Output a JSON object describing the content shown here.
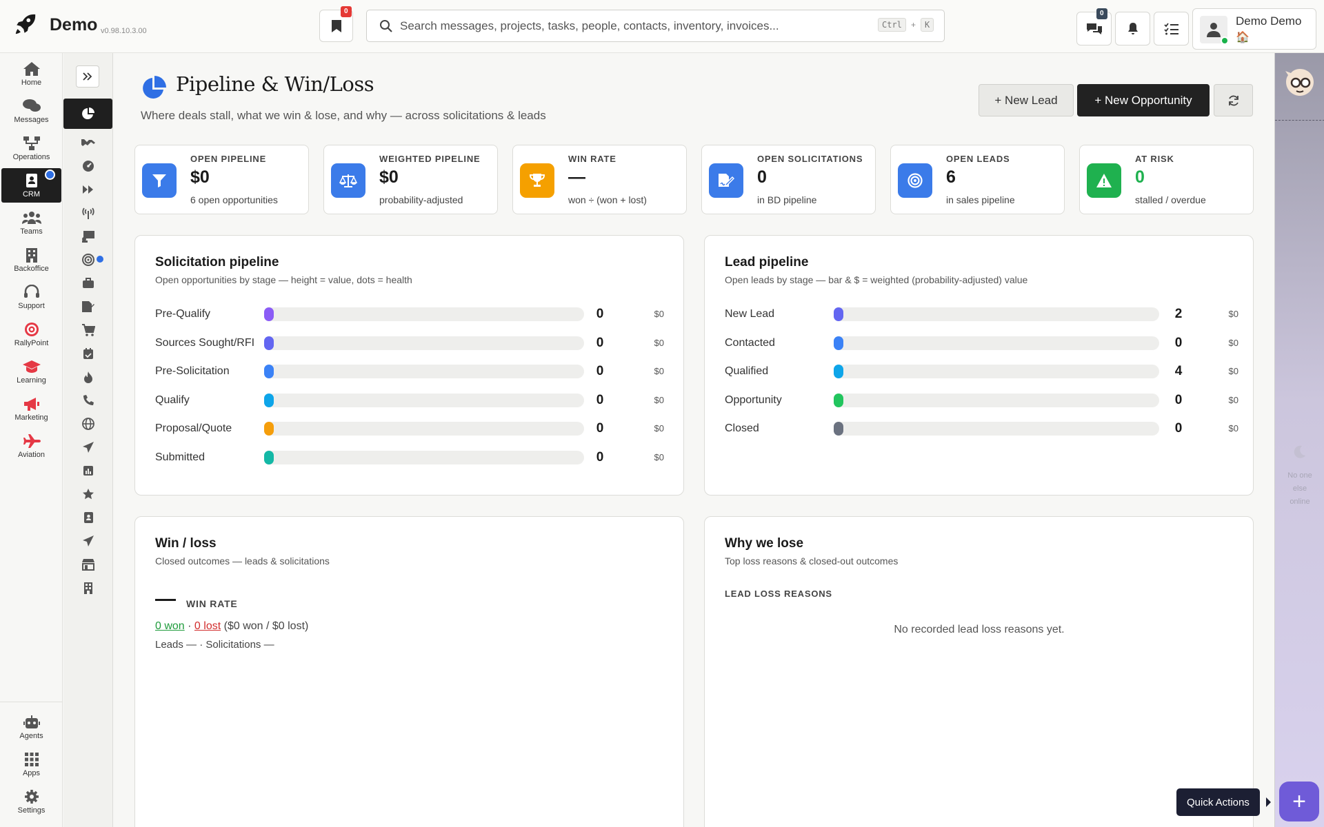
{
  "app": {
    "name": "Demo",
    "version": "v0.98.10.3.00"
  },
  "topbar": {
    "bookmark_badge": "0",
    "search_placeholder": "Search messages, projects, tasks, people, contacts, inventory, invoices...",
    "shortcut_ctrl": "Ctrl",
    "shortcut_plus": "+",
    "shortcut_key": "K",
    "chat_badge": "0",
    "user_name": "Demo Demo",
    "user_home_icon": "🏠"
  },
  "leftnav": {
    "items": [
      {
        "label": "Home",
        "icon": "home-icon"
      },
      {
        "label": "Messages",
        "icon": "messages-icon"
      },
      {
        "label": "Operations",
        "icon": "operations-icon"
      },
      {
        "label": "CRM",
        "icon": "crm-icon",
        "active": true
      },
      {
        "label": "Teams",
        "icon": "teams-icon"
      },
      {
        "label": "Backoffice",
        "icon": "building-icon"
      },
      {
        "label": "Support",
        "icon": "headset-icon"
      },
      {
        "label": "RallyPoint",
        "icon": "target-icon"
      },
      {
        "label": "Learning",
        "icon": "graduation-icon"
      },
      {
        "label": "Marketing",
        "icon": "megaphone-icon"
      },
      {
        "label": "Aviation",
        "icon": "plane-icon"
      }
    ],
    "bottom": [
      {
        "label": "Agents",
        "icon": "robot-icon"
      },
      {
        "label": "Apps",
        "icon": "grid-icon"
      },
      {
        "label": "Settings",
        "icon": "gear-icon"
      }
    ]
  },
  "rightrail": {
    "presence_text": [
      "No one",
      "else",
      "online"
    ]
  },
  "page": {
    "title": "Pipeline & Win/Loss",
    "subtitle": "Where deals stall, what we win & lose, and why — across solicitations & leads",
    "new_lead": "+ New Lead",
    "new_opportunity": "+ New Opportunity"
  },
  "kpis": [
    {
      "label": "OPEN PIPELINE",
      "value": "$0",
      "note": "6 open opportunities",
      "color": "#3b7be9",
      "icon": "filter-icon"
    },
    {
      "label": "WEIGHTED PIPELINE",
      "value": "$0",
      "note": "probability-adjusted",
      "color": "#3b7be9",
      "icon": "scale-icon"
    },
    {
      "label": "WIN RATE",
      "value": "—",
      "note": "won ÷ (won + lost)",
      "color": "#f5a000",
      "icon": "trophy-icon"
    },
    {
      "label": "OPEN SOLICITATIONS",
      "value": "0",
      "note": "in BD pipeline",
      "color": "#3b7be9",
      "icon": "file-signature-icon"
    },
    {
      "label": "OPEN LEADS",
      "value": "6",
      "note": "in sales pipeline",
      "color": "#3b7be9",
      "icon": "bullseye-icon"
    },
    {
      "label": "AT RISK",
      "value": "0",
      "note": "stalled / overdue",
      "color": "#1fb14f",
      "value_color": "#1fb14f",
      "icon": "warning-icon"
    }
  ],
  "solicitation_pipeline": {
    "title": "Solicitation pipeline",
    "subtitle": "Open opportunities by stage — height = value, dots = health",
    "stages": [
      {
        "label": "Pre-Qualify",
        "count": "0",
        "amount": "$0",
        "color": "#8b5cf6"
      },
      {
        "label": "Sources Sought/RFI",
        "count": "0",
        "amount": "$0",
        "color": "#6366f1"
      },
      {
        "label": "Pre-Solicitation",
        "count": "0",
        "amount": "$0",
        "color": "#3b82f6"
      },
      {
        "label": "Qualify",
        "count": "0",
        "amount": "$0",
        "color": "#0ea5e9"
      },
      {
        "label": "Proposal/Quote",
        "count": "0",
        "amount": "$0",
        "color": "#f59e0b"
      },
      {
        "label": "Submitted",
        "count": "0",
        "amount": "$0",
        "color": "#14b8a6"
      }
    ]
  },
  "lead_pipeline": {
    "title": "Lead pipeline",
    "subtitle": "Open leads by stage — bar & $ = weighted (probability-adjusted) value",
    "stages": [
      {
        "label": "New Lead",
        "count": "2",
        "amount": "$0",
        "color": "#6366f1"
      },
      {
        "label": "Contacted",
        "count": "0",
        "amount": "$0",
        "color": "#3b82f6"
      },
      {
        "label": "Qualified",
        "count": "4",
        "amount": "$0",
        "color": "#0ea5e9"
      },
      {
        "label": "Opportunity",
        "count": "0",
        "amount": "$0",
        "color": "#22c55e"
      },
      {
        "label": "Closed",
        "count": "0",
        "amount": "$0",
        "color": "#6b7280"
      }
    ]
  },
  "win_loss": {
    "title": "Win / loss",
    "subtitle": "Closed outcomes — leads & solicitations",
    "win_rate_label": "WIN RATE",
    "won": "0 won",
    "separator": " · ",
    "lost": "0 lost",
    "amounts": " ($0 won / $0 lost)",
    "meta": "Leads — · Solicitations —"
  },
  "why_we_lose": {
    "title": "Why we lose",
    "subtitle": "Top loss reasons & closed-out outcomes",
    "section": "LEAD LOSS REASONS",
    "empty": "No recorded lead loss reasons yet."
  },
  "quick_actions": {
    "label": "Quick Actions",
    "fab": "+"
  }
}
